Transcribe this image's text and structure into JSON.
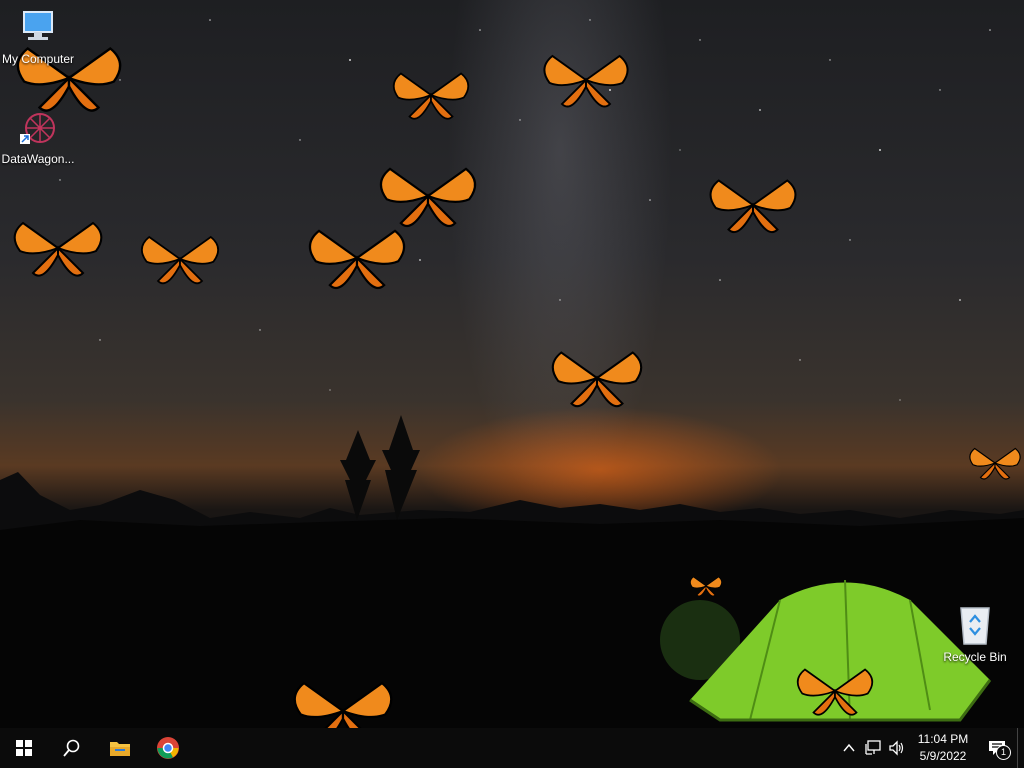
{
  "desktop": {
    "icons": [
      {
        "label": "My Computer"
      },
      {
        "label": "DataWagon..."
      },
      {
        "label": "Recycle Bin"
      }
    ]
  },
  "taskbar": {
    "items": [
      "start-icon",
      "search-icon",
      "file-explorer-icon",
      "chrome-icon"
    ],
    "clock": {
      "time": "11:04 PM",
      "date": "5/9/2022"
    },
    "notifications_count": "1"
  }
}
